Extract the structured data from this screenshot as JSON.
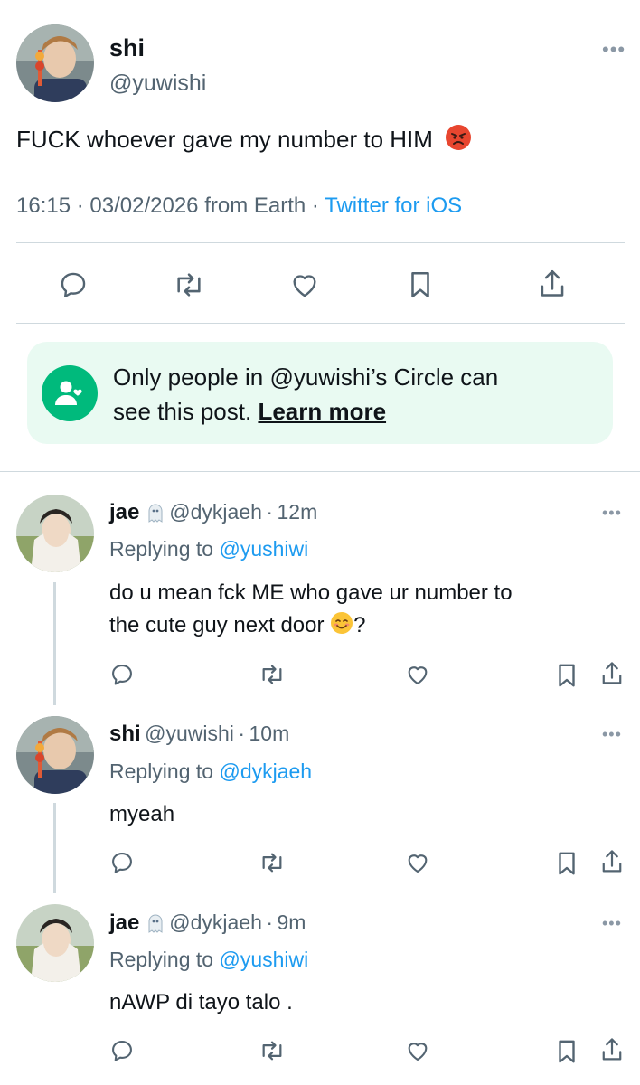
{
  "main_tweet": {
    "name": "shi",
    "handle": "@yuwishi",
    "text": "FUCK whoever gave my number to HIM",
    "emoji": "😡",
    "time": "16:15",
    "date": "03/02/2026",
    "from": "from Earth",
    "source": "Twitter for iOS"
  },
  "actions": {
    "reply_icon": "reply-icon",
    "retweet_icon": "retweet-icon",
    "like_icon": "heart-icon",
    "bookmark_icon": "bookmark-icon",
    "share_icon": "share-icon"
  },
  "circle_notice": {
    "text_1": "Only people in @yuwishi’s Circle can",
    "text_2": "see this post.",
    "link": "Learn more",
    "color": "#00ba7c"
  },
  "replies": [
    {
      "name": "jae",
      "handle": "@dykjaeh",
      "sep": "·",
      "age": "12m",
      "replying_label": "Replying to",
      "replying_to": "@yushiwi",
      "text_line1": "do u mean fck ME who gave ur number to",
      "text_line2": "the cute guy next door",
      "emoji": "😊",
      "text_end": "?"
    },
    {
      "name": "shi",
      "handle": "@yuwishi",
      "sep": "·",
      "age": "10m",
      "replying_label": "Replying to",
      "replying_to": "@dykjaeh",
      "text_line1": "myeah"
    },
    {
      "name": "jae",
      "handle": "@dykjaeh",
      "sep": "·",
      "age": "9m",
      "replying_label": "Replying to",
      "replying_to": "@yushiwi",
      "text_line1": "nAWP di tayo talo ."
    }
  ],
  "colors": {
    "link": "#1d9bf0",
    "secondary": "#536471",
    "divider": "#cfd9de"
  }
}
